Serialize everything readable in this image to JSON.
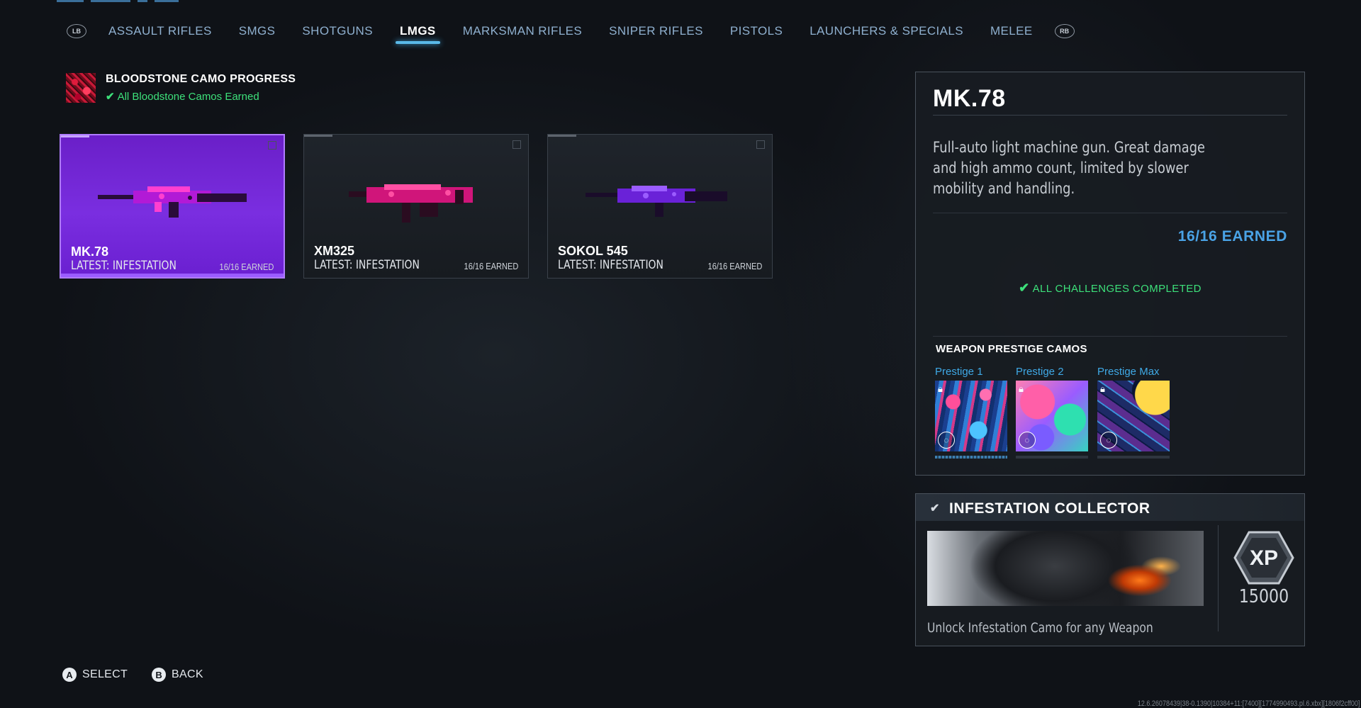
{
  "nav": {
    "left_bumper": "LB",
    "right_bumper": "RB",
    "tabs": [
      {
        "label": "ASSAULT RIFLES"
      },
      {
        "label": "SMGS"
      },
      {
        "label": "SHOTGUNS"
      },
      {
        "label": "LMGS",
        "active": true
      },
      {
        "label": "MARKSMAN RIFLES"
      },
      {
        "label": "SNIPER RIFLES"
      },
      {
        "label": "PISTOLS"
      },
      {
        "label": "LAUNCHERS & SPECIALS"
      },
      {
        "label": "MELEE"
      }
    ]
  },
  "camo_progress": {
    "title": "BLOODSTONE CAMO PROGRESS",
    "status": "All Bloodstone Camos Earned",
    "status_color": "#3de07a"
  },
  "weapons": [
    {
      "name": "MK.78",
      "latest": "LATEST: INFESTATION",
      "earned": "16/16 EARNED",
      "selected": true,
      "camo_colors": [
        "#b21ad6",
        "#ff3fd0",
        "#2a0c3a"
      ]
    },
    {
      "name": "XM325",
      "latest": "LATEST: INFESTATION",
      "earned": "16/16 EARNED",
      "selected": false,
      "camo_colors": [
        "#d0157a",
        "#ff4fa3",
        "#2a0c20"
      ]
    },
    {
      "name": "SOKOL 545",
      "latest": "LATEST: INFESTATION",
      "earned": "16/16 EARNED",
      "selected": false,
      "camo_colors": [
        "#6a22d8",
        "#9b5cff",
        "#1a0c2a"
      ]
    }
  ],
  "detail": {
    "title": "MK.78",
    "description": "Full-auto light machine gun. Great damage and high ammo count, limited by slower mobility and handling.",
    "earned": "16/16 EARNED",
    "challenges_status": "ALL CHALLENGES COMPLETED",
    "prestige_title": "WEAPON PRESTIGE CAMOS",
    "prestige_camos": [
      {
        "label": "Prestige 1",
        "locked": true,
        "icon": "lock-icon"
      },
      {
        "label": "Prestige 2",
        "locked": true,
        "icon": "lock-icon"
      },
      {
        "label": "Prestige Max",
        "locked": true,
        "icon": "lock-icon"
      }
    ]
  },
  "challenge": {
    "title": "INFESTATION COLLECTOR",
    "xp_label": "XP",
    "xp_value": "15000",
    "description": "Unlock Infestation Camo for any Weapon"
  },
  "footer": {
    "select_button": "A",
    "select_label": "SELECT",
    "back_button": "B",
    "back_label": "BACK"
  },
  "build_string": "12.6.26078439|38-0.1390|10384+11:[7400][1774990493.pl.6.xbx][1806f2cff00]",
  "colors": {
    "accent": "#5ab9e8",
    "selected_card": "#7a2ee0",
    "earned_blue": "#4aa3e6",
    "success_green": "#3de07a"
  }
}
